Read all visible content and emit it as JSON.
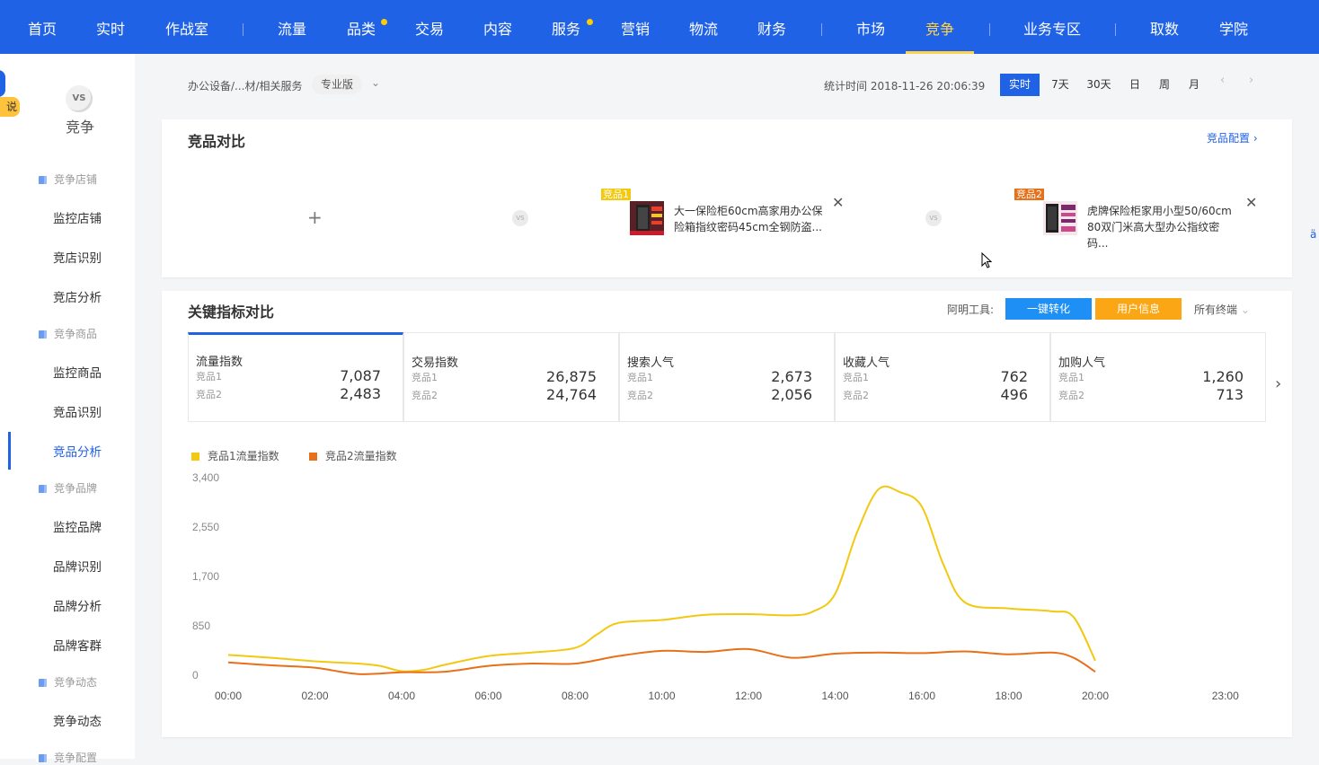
{
  "topnav": {
    "items": [
      {
        "label": "首页"
      },
      {
        "label": "实时"
      },
      {
        "label": "作战室"
      },
      {
        "label": "流量"
      },
      {
        "label": "品类"
      },
      {
        "label": "交易"
      },
      {
        "label": "内容"
      },
      {
        "label": "服务"
      },
      {
        "label": "营销"
      },
      {
        "label": "物流"
      },
      {
        "label": "财务"
      },
      {
        "label": "市场"
      },
      {
        "label": "竞争"
      },
      {
        "label": "业务专区"
      },
      {
        "label": "取数"
      },
      {
        "label": "学院"
      }
    ],
    "active": "竞争"
  },
  "sidebar": {
    "help_label": "说明",
    "logo_text": "VS",
    "module_title": "竞争",
    "groups": [
      {
        "header": "竞争店铺",
        "items": [
          "监控店铺",
          "竞店识别",
          "竞店分析"
        ]
      },
      {
        "header": "竞争商品",
        "items": [
          "监控商品",
          "竞品识别",
          "竞品分析"
        ]
      },
      {
        "header": "竞争品牌",
        "items": [
          "监控品牌",
          "品牌识别",
          "品牌分析",
          "品牌客群"
        ]
      },
      {
        "header": "竞争动态",
        "items": [
          "竞争动态"
        ]
      },
      {
        "header": "竞争配置",
        "items": []
      }
    ],
    "active_item": "竞品分析"
  },
  "subheader": {
    "breadcrumb": "办公设备/...材/相关服务",
    "edition": "专业版",
    "stat_time": "统计时间 2018-11-26 20:06:39",
    "time_tabs": [
      "实时",
      "7天",
      "30天",
      "日",
      "周",
      "月"
    ],
    "active_tab": "实时",
    "prev": "‹",
    "next": "›"
  },
  "compare": {
    "title": "竞品对比",
    "config_link": "竞品配置 ›",
    "add_symbol": "+",
    "vs_text": "VS",
    "products": [
      {
        "tag": "竞品1",
        "tag_color": "#f2c811",
        "name": "大一保险柜60cm高家用办公保险箱指纹密码45cm全钢防盗..."
      },
      {
        "tag": "竞品2",
        "tag_color": "#e8701a",
        "name": "虎牌保险柜家用小型50/60cm 80双门米高大型办公指纹密码..."
      }
    ]
  },
  "metrics_section": {
    "title": "关键指标对比",
    "tool_label": "阿明工具:",
    "btn_convert": "一键转化",
    "btn_userinfo": "用户信息",
    "terminal": "所有终端",
    "label_a": "竞品1",
    "label_b": "竞品2",
    "cards": [
      {
        "name": "流量指数",
        "v1": "7,087",
        "v2": "2,483"
      },
      {
        "name": "交易指数",
        "v1": "26,875",
        "v2": "24,764"
      },
      {
        "name": "搜索人气",
        "v1": "2,673",
        "v2": "2,056"
      },
      {
        "name": "收藏人气",
        "v1": "762",
        "v2": "496"
      },
      {
        "name": "加购人气",
        "v1": "1,260",
        "v2": "713"
      }
    ],
    "next_arrow": "›"
  },
  "chart_data": {
    "type": "line",
    "title": "",
    "xlabel": "",
    "ylabel": "",
    "x_ticks": [
      "00:00",
      "02:00",
      "04:00",
      "06:00",
      "08:00",
      "10:00",
      "12:00",
      "14:00",
      "16:00",
      "18:00",
      "20:00",
      "23:00"
    ],
    "y_ticks": [
      "3,400",
      "2,550",
      "1,700",
      "850",
      "0"
    ],
    "ylim": [
      0,
      3400
    ],
    "grid": false,
    "legend_position": "top-left",
    "series": [
      {
        "name": "竞品1流量指数",
        "color": "#f2c811",
        "points": [
          [
            0,
            350
          ],
          [
            1,
            300
          ],
          [
            2,
            240
          ],
          [
            3,
            200
          ],
          [
            3.5,
            160
          ],
          [
            4,
            70
          ],
          [
            4.5,
            90
          ],
          [
            5,
            180
          ],
          [
            6,
            330
          ],
          [
            7,
            390
          ],
          [
            8,
            470
          ],
          [
            8.5,
            700
          ],
          [
            9,
            900
          ],
          [
            10,
            950
          ],
          [
            11,
            1040
          ],
          [
            12,
            1050
          ],
          [
            13,
            1030
          ],
          [
            13.5,
            1100
          ],
          [
            14,
            1400
          ],
          [
            14.5,
            2450
          ],
          [
            15,
            3200
          ],
          [
            15.5,
            3150
          ],
          [
            16,
            2900
          ],
          [
            16.5,
            1900
          ],
          [
            17,
            1250
          ],
          [
            18,
            1150
          ],
          [
            19,
            1100
          ],
          [
            19.5,
            1000
          ],
          [
            20,
            250
          ]
        ]
      },
      {
        "name": "竞品2流量指数",
        "color": "#e8701a",
        "points": [
          [
            0,
            220
          ],
          [
            1,
            170
          ],
          [
            2,
            130
          ],
          [
            3,
            20
          ],
          [
            4,
            50
          ],
          [
            5,
            60
          ],
          [
            6,
            160
          ],
          [
            7,
            200
          ],
          [
            8,
            200
          ],
          [
            9,
            330
          ],
          [
            10,
            420
          ],
          [
            11,
            400
          ],
          [
            12,
            450
          ],
          [
            13,
            300
          ],
          [
            14,
            370
          ],
          [
            15,
            390
          ],
          [
            16,
            380
          ],
          [
            17,
            410
          ],
          [
            18,
            360
          ],
          [
            19,
            390
          ],
          [
            19.5,
            300
          ],
          [
            20,
            60
          ]
        ]
      }
    ]
  },
  "colors": {
    "brand_blue": "#2062e6",
    "nav_active": "#ffd44c",
    "btn_convert": "#1e8ff5",
    "btn_userinfo": "#fba614"
  }
}
